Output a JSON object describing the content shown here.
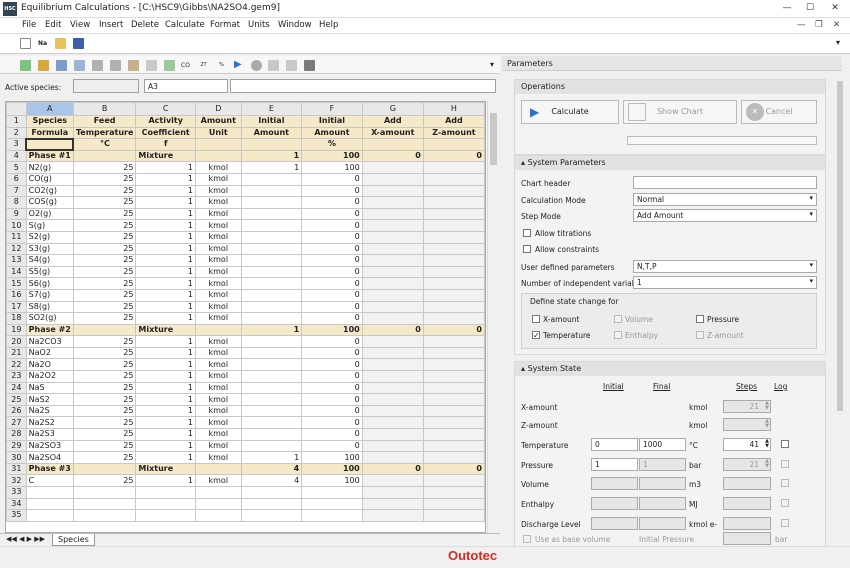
{
  "window": {
    "title": "Equilibrium Calculations - [C:\\HSC9\\Gibbs\\NA2SO4.gem9]",
    "minimize": "—",
    "maximize": "☐",
    "close": "✕"
  },
  "menu": [
    "File",
    "Edit",
    "View",
    "Insert",
    "Delete",
    "Calculate",
    "Format",
    "Units",
    "Window",
    "Help"
  ],
  "active_species": {
    "label": "Active species:",
    "name_value": "",
    "cell_ref": "A3",
    "formula_value": ""
  },
  "grid": {
    "columns": [
      "A",
      "B",
      "C",
      "D",
      "E",
      "F",
      "G",
      "H"
    ],
    "header1": [
      "Species",
      "Feed",
      "Activity",
      "Amount",
      "Initial",
      "Initial",
      "Add",
      "Add"
    ],
    "header2": [
      "Formula",
      "Temperature",
      "Coefficient",
      "Unit",
      "Amount",
      "Amount",
      "X-amount",
      "Z-amount"
    ],
    "header3": [
      "",
      "°C",
      "f",
      "",
      "",
      "%",
      "",
      ""
    ],
    "rows": [
      {
        "n": "4",
        "type": "phase",
        "cells": [
          "Phase #1",
          "",
          "Mixture",
          "",
          "1",
          "100",
          "0",
          "0"
        ]
      },
      {
        "n": "5",
        "cells": [
          "N2(g)",
          "25",
          "1",
          "kmol",
          "1",
          "100",
          "",
          ""
        ]
      },
      {
        "n": "6",
        "cells": [
          "CO(g)",
          "25",
          "1",
          "kmol",
          "",
          "0",
          "",
          ""
        ]
      },
      {
        "n": "7",
        "cells": [
          "CO2(g)",
          "25",
          "1",
          "kmol",
          "",
          "0",
          "",
          ""
        ]
      },
      {
        "n": "8",
        "cells": [
          "COS(g)",
          "25",
          "1",
          "kmol",
          "",
          "0",
          "",
          ""
        ]
      },
      {
        "n": "9",
        "cells": [
          "O2(g)",
          "25",
          "1",
          "kmol",
          "",
          "0",
          "",
          ""
        ]
      },
      {
        "n": "10",
        "cells": [
          "S(g)",
          "25",
          "1",
          "kmol",
          "",
          "0",
          "",
          ""
        ]
      },
      {
        "n": "11",
        "cells": [
          "S2(g)",
          "25",
          "1",
          "kmol",
          "",
          "0",
          "",
          ""
        ]
      },
      {
        "n": "12",
        "cells": [
          "S3(g)",
          "25",
          "1",
          "kmol",
          "",
          "0",
          "",
          ""
        ]
      },
      {
        "n": "13",
        "cells": [
          "S4(g)",
          "25",
          "1",
          "kmol",
          "",
          "0",
          "",
          ""
        ]
      },
      {
        "n": "14",
        "cells": [
          "S5(g)",
          "25",
          "1",
          "kmol",
          "",
          "0",
          "",
          ""
        ]
      },
      {
        "n": "15",
        "cells": [
          "S6(g)",
          "25",
          "1",
          "kmol",
          "",
          "0",
          "",
          ""
        ]
      },
      {
        "n": "16",
        "cells": [
          "S7(g)",
          "25",
          "1",
          "kmol",
          "",
          "0",
          "",
          ""
        ]
      },
      {
        "n": "17",
        "cells": [
          "S8(g)",
          "25",
          "1",
          "kmol",
          "",
          "0",
          "",
          ""
        ]
      },
      {
        "n": "18",
        "cells": [
          "SO2(g)",
          "25",
          "1",
          "kmol",
          "",
          "0",
          "",
          ""
        ]
      },
      {
        "n": "19",
        "type": "phase",
        "cells": [
          "Phase #2",
          "",
          "Mixture",
          "",
          "1",
          "100",
          "0",
          "0"
        ]
      },
      {
        "n": "20",
        "cells": [
          "Na2CO3",
          "25",
          "1",
          "kmol",
          "",
          "0",
          "",
          ""
        ]
      },
      {
        "n": "21",
        "cells": [
          "NaO2",
          "25",
          "1",
          "kmol",
          "",
          "0",
          "",
          ""
        ]
      },
      {
        "n": "22",
        "cells": [
          "Na2O",
          "25",
          "1",
          "kmol",
          "",
          "0",
          "",
          ""
        ]
      },
      {
        "n": "23",
        "cells": [
          "Na2O2",
          "25",
          "1",
          "kmol",
          "",
          "0",
          "",
          ""
        ]
      },
      {
        "n": "24",
        "cells": [
          "NaS",
          "25",
          "1",
          "kmol",
          "",
          "0",
          "",
          ""
        ]
      },
      {
        "n": "25",
        "cells": [
          "NaS2",
          "25",
          "1",
          "kmol",
          "",
          "0",
          "",
          ""
        ]
      },
      {
        "n": "26",
        "cells": [
          "Na2S",
          "25",
          "1",
          "kmol",
          "",
          "0",
          "",
          ""
        ]
      },
      {
        "n": "27",
        "cells": [
          "Na2S2",
          "25",
          "1",
          "kmol",
          "",
          "0",
          "",
          ""
        ]
      },
      {
        "n": "28",
        "cells": [
          "Na2S3",
          "25",
          "1",
          "kmol",
          "",
          "0",
          "",
          ""
        ]
      },
      {
        "n": "29",
        "cells": [
          "Na2SO3",
          "25",
          "1",
          "kmol",
          "",
          "0",
          "",
          ""
        ]
      },
      {
        "n": "30",
        "cells": [
          "Na2SO4",
          "25",
          "1",
          "kmol",
          "1",
          "100",
          "",
          ""
        ]
      },
      {
        "n": "31",
        "type": "phase",
        "cells": [
          "Phase #3",
          "",
          "Mixture",
          "",
          "4",
          "100",
          "0",
          "0"
        ]
      },
      {
        "n": "32",
        "cells": [
          "C",
          "25",
          "1",
          "kmol",
          "4",
          "100",
          "",
          ""
        ]
      },
      {
        "n": "33",
        "cells": [
          "",
          "",
          "",
          "",
          "",
          "",
          "",
          ""
        ]
      },
      {
        "n": "34",
        "cells": [
          "",
          "",
          "",
          "",
          "",
          "",
          "",
          ""
        ]
      },
      {
        "n": "35",
        "cells": [
          "",
          "",
          "",
          "",
          "",
          "",
          "",
          ""
        ]
      }
    ],
    "sheet_tab": "Species"
  },
  "params": {
    "title": "Parameters",
    "operations": {
      "title": "Operations",
      "calculate": "Calculate",
      "show_chart": "Show Chart",
      "cancel": "Cancel"
    },
    "system_parameters": {
      "title": "System Parameters",
      "chart_header_label": "Chart header",
      "chart_header_value": "",
      "calc_mode_label": "Calculation Mode",
      "calc_mode_value": "Normal",
      "step_mode_label": "Step Mode",
      "step_mode_value": "Add Amount",
      "allow_titrations": "Allow titrations",
      "allow_constraints": "Allow constraints",
      "udp_label": "User defined parameters",
      "udp_value": "N,T,P",
      "niv_label": "Number of independent variables",
      "niv_value": "1",
      "state_change_title": "Define state change for",
      "state_options": [
        "X-amount",
        "Volume",
        "Pressure",
        "Temperature",
        "Enthalpy",
        "Z-amount"
      ]
    },
    "system_state": {
      "title": "System State",
      "col_initial": "Initial",
      "col_final": "Final",
      "col_steps": "Steps",
      "col_log": "Log",
      "rows": [
        {
          "label": "X-amount",
          "initial": "",
          "final": "",
          "unit": "kmol",
          "steps": "21"
        },
        {
          "label": "Z-amount",
          "initial": "",
          "final": "",
          "unit": "kmol",
          "steps": ""
        },
        {
          "label": "Temperature",
          "initial": "0",
          "final": "1000",
          "unit": "°C",
          "steps": "41"
        },
        {
          "label": "Pressure",
          "initial": "1",
          "final": "1",
          "unit": "bar",
          "steps": "21"
        },
        {
          "label": "Volume",
          "initial": "",
          "final": "",
          "unit": "m3",
          "steps": ""
        },
        {
          "label": "Enthalpy",
          "initial": "",
          "final": "",
          "unit": "MJ",
          "steps": ""
        },
        {
          "label": "Discharge Level",
          "initial": "",
          "final": "",
          "unit": "kmol e-",
          "steps": ""
        }
      ],
      "base_volume": "Use as base volume",
      "initial_pressure": "Initial Pressure",
      "ip_unit": "bar"
    }
  },
  "brand": "Outotec"
}
